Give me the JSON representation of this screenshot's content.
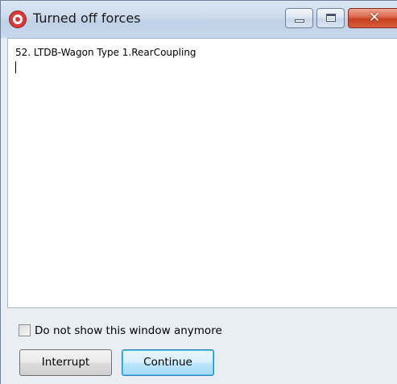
{
  "window": {
    "title": "Turned off forces",
    "icon": "app-target-icon"
  },
  "titlebar_buttons": {
    "minimize_icon": "minimize-icon",
    "maximize_icon": "maximize-icon",
    "close_label": "✕"
  },
  "content": {
    "lines": [
      "52. LTDB-Wagon Type 1.RearCoupling"
    ]
  },
  "options": {
    "dont_show_label": "Do not show this window anymore",
    "dont_show_checked": false
  },
  "buttons": {
    "interrupt_label": "Interrupt",
    "continue_label": "Continue"
  },
  "colors": {
    "close_button": "#c7401f",
    "default_button_border": "#3c7fb1"
  }
}
